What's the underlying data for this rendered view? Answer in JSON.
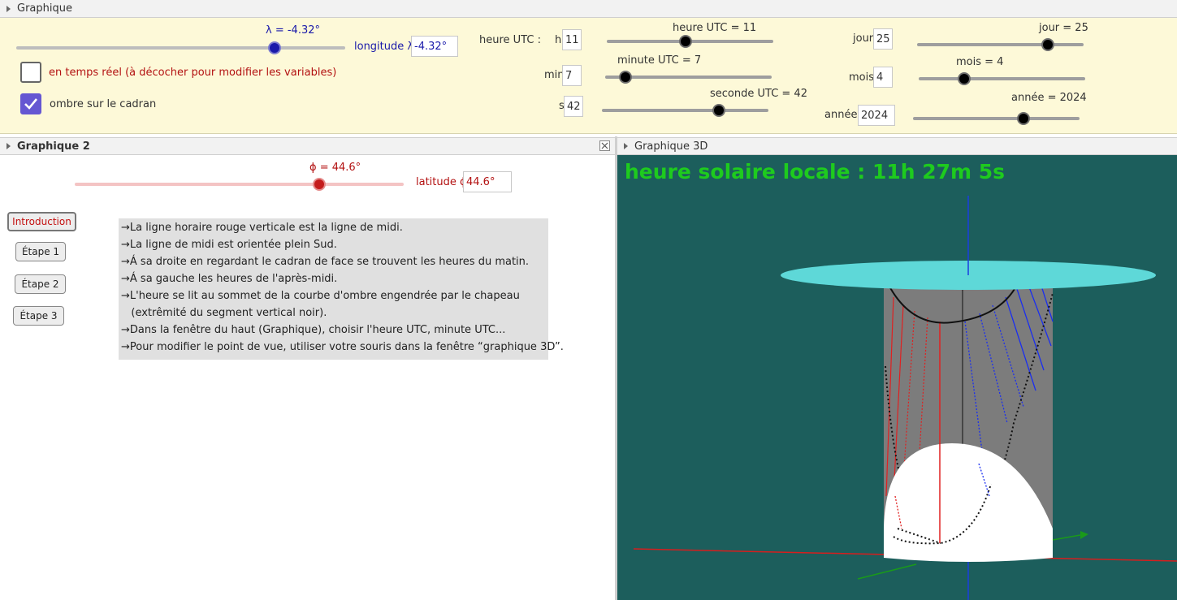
{
  "top_title": "Graphique",
  "lambda_slider": {
    "label": "λ = -4.32°",
    "value_fraction": 0.78
  },
  "longitude": {
    "label": "longitude λ",
    "value": "-4.32°"
  },
  "realtime_checkbox": {
    "label": "en temps réel (à décocher pour modifier les variables)",
    "checked": false
  },
  "shadow_checkbox": {
    "label": "ombre sur le cadran",
    "checked": true
  },
  "time": {
    "heading": "heure UTC :",
    "h_label": "h",
    "h_value": "11",
    "min_label": "min",
    "min_value": "7",
    "s_label": "s",
    "s_value": "42",
    "hour_slider": {
      "label": "heure UTC = 11",
      "value_fraction": 0.48
    },
    "minute_slider": {
      "label": "minute UTC = 7",
      "value_fraction": 0.12
    },
    "second_slider": {
      "label": "seconde UTC = 42",
      "value_fraction": 0.71
    }
  },
  "date": {
    "jour_label": "jour",
    "jour_value": "25",
    "mois_label": "mois",
    "mois_value": "4",
    "annee_label": "année",
    "annee_value": "2024",
    "jour_slider": {
      "label": "jour = 25",
      "value_fraction": 0.8
    },
    "mois_slider": {
      "label": "mois = 4",
      "value_fraction": 0.27
    },
    "annee_slider": {
      "label": "année = 2024",
      "value_fraction": 0.67
    }
  },
  "panel2": {
    "title": "Graphique 2",
    "phi_slider": {
      "label": "ϕ = 44.6°",
      "value_fraction": 0.74
    },
    "latitude": {
      "label": "latitude ϕ",
      "value": "44.6°"
    },
    "buttons": {
      "intro": "Introduction",
      "step1": "Étape 1",
      "step2": "Étape 2",
      "step3": "Étape 3"
    },
    "info_lines": [
      "→La ligne horaire rouge verticale est la ligne de midi.",
      "→La ligne de midi est orientée plein Sud.",
      "→Á sa droite en regardant le cadran de face se trouvent les heures du matin.",
      "→Á sa gauche les heures de l'après-midi.",
      "→L'heure se lit au sommet de la courbe d'ombre engendrée par le chapeau",
      "   (extrêmité du segment vertical noir).",
      "→Dans la fenêtre du haut (Graphique), choisir l'heure UTC, minute UTC...",
      "→Pour modifier le point de vue, utiliser votre souris dans la fenêtre “graphique 3D”."
    ]
  },
  "panel3d": {
    "title": "Graphique 3D",
    "solar_time": "heure solaire locale : 11h 27m 5s"
  },
  "colors": {
    "panel_bg": "#fdf9d8",
    "view3d_bg": "#1c5e5c",
    "solar_text": "#1ecb1e",
    "accent_blue": "#1a1aaa",
    "accent_red": "#b31212",
    "checkbox": "#6557d2"
  }
}
